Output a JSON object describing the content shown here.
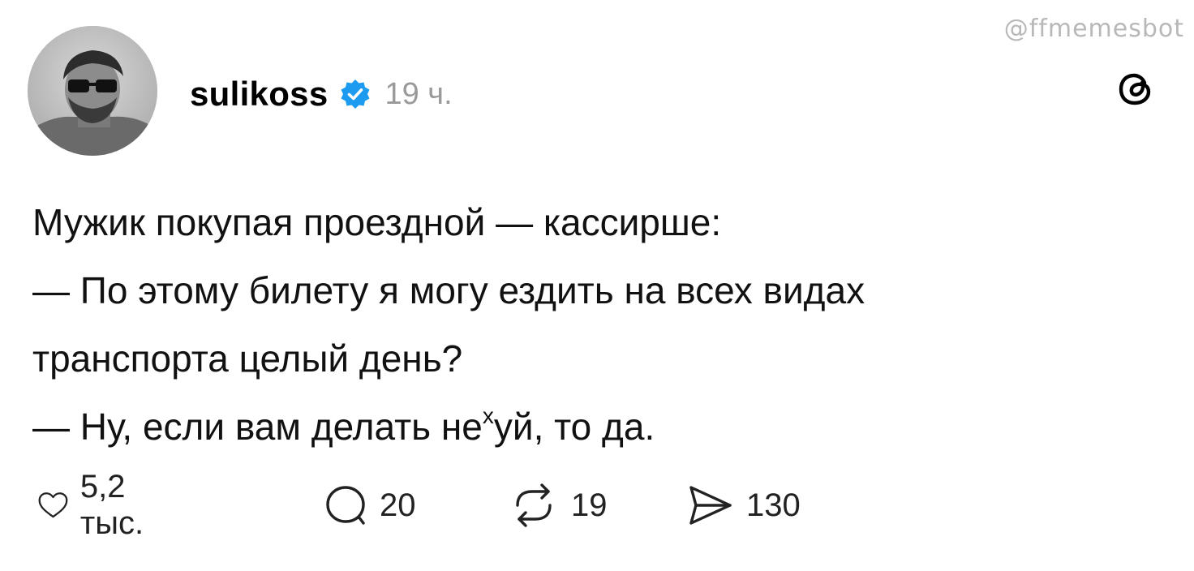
{
  "watermark": "@ffmemesbot",
  "post": {
    "username": "sulikoss",
    "timestamp": "19 ч.",
    "verified_color": "#1d9bf0",
    "lines": [
      "Мужик покупая проездной — кассирше:",
      "— По этому билету я могу ездить на всех видах",
      "транспорта целый день?"
    ],
    "last_line_before": "— Ну, если вам делать не",
    "last_line_sup": "х",
    "last_line_after": "уй, то да."
  },
  "actions": {
    "like": {
      "icon": "heart-icon",
      "count": "5,2 тыс."
    },
    "comment": {
      "icon": "comment-icon",
      "count": "20"
    },
    "repost": {
      "icon": "repost-icon",
      "count": "19"
    },
    "share": {
      "icon": "send-icon",
      "count": "130"
    }
  },
  "app_icon": "threads-logo-icon"
}
